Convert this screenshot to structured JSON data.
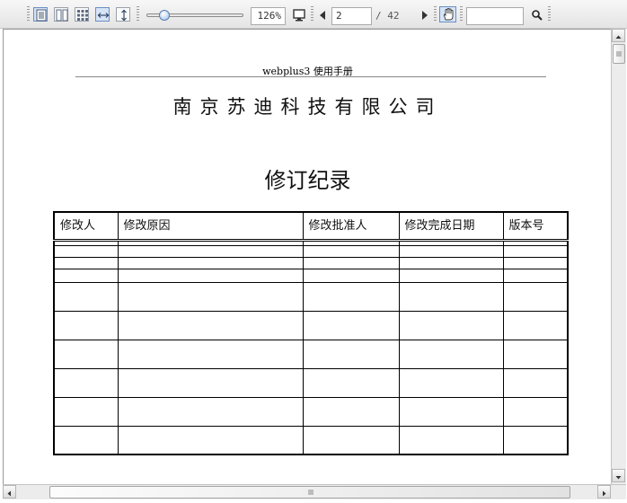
{
  "toolbar": {
    "zoom": "126%",
    "current_page": "2",
    "page_total": "/ 42",
    "search_value": "",
    "view_modes": [
      "single-page",
      "two-page",
      "thumbnail-grid",
      "fit-width",
      "fit-height"
    ],
    "icons": {
      "fullscreen": "monitor-icon",
      "prev": "triangle-left-icon",
      "next": "triangle-right-icon",
      "hand": "hand-icon",
      "search": "magnifier-icon"
    }
  },
  "document": {
    "header": "webplus3 使用手册",
    "company": "南京苏迪科技有限公司",
    "title": "修订纪录",
    "table": {
      "columns": [
        "修改人",
        "修改原因",
        "修改批准人",
        "修改完成日期",
        "版本号"
      ],
      "row_count": 10
    }
  },
  "colors": {
    "toolbar_bg": "#e9e9e9",
    "active_button": "#d6e4f7",
    "page_bg": "#ffffff"
  }
}
